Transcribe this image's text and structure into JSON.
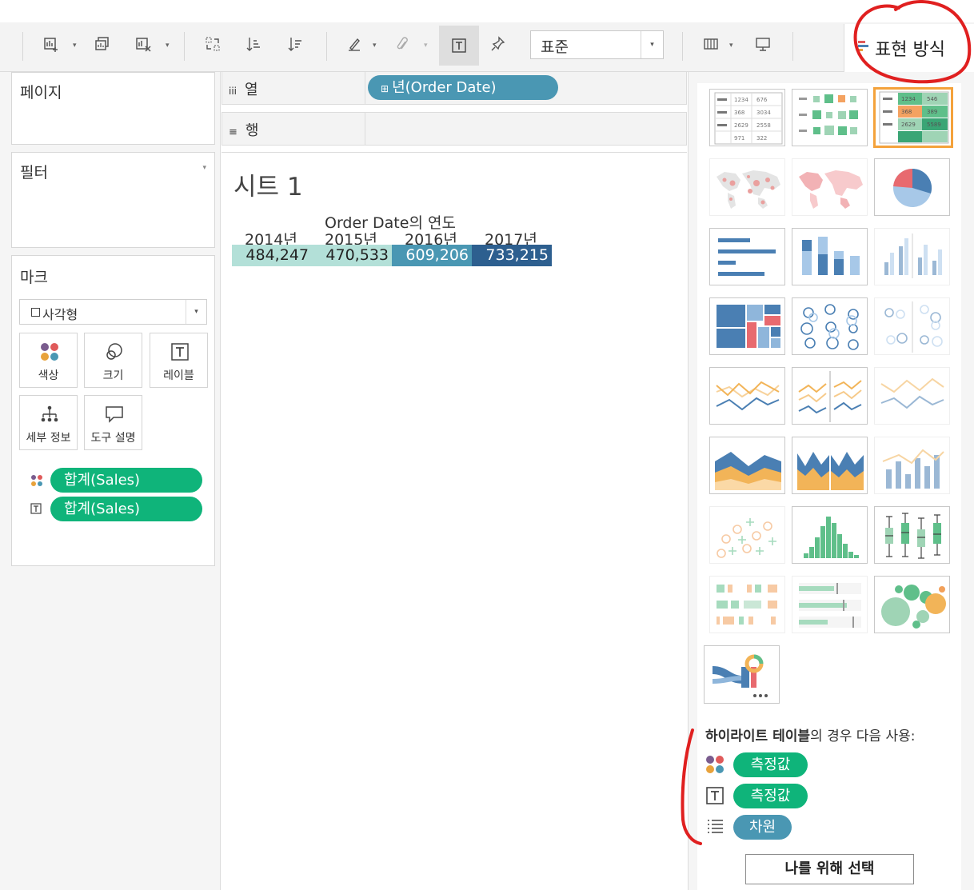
{
  "toolbar": {
    "zoom_value": "표준",
    "show_me_label": "표현 방식"
  },
  "panels": {
    "pages_title": "페이지",
    "filters_title": "필터",
    "marks_title": "마크",
    "mark_type": "사각형",
    "mark_cards": [
      "색상",
      "크기",
      "레이블",
      "세부 정보",
      "도구 설명"
    ],
    "mark_pills": [
      "합계(Sales)",
      "합계(Sales)"
    ]
  },
  "shelves": {
    "columns_label": "열",
    "rows_label": "행",
    "columns_pill": "년(Order Date)"
  },
  "worksheet": {
    "title": "시트 1",
    "column_header": "Order Date의 연도",
    "years": [
      "2014년",
      "2015년",
      "2016년",
      "2017년"
    ],
    "values": [
      "484,247",
      "470,533",
      "609,206",
      "733,215"
    ],
    "cell_colors": [
      "#b3e0d8",
      "#b3e0d8",
      "#4a97b3",
      "#2d5f8f"
    ],
    "cell_text_colors": [
      "#222222",
      "#222222",
      "#ffffff",
      "#ffffff"
    ]
  },
  "show_me": {
    "hint_bold": "하이라이트 테이블",
    "hint_rest": "의 경우 다음 사용:",
    "requirements": [
      "측정값",
      "측정값",
      "차원"
    ],
    "choose_button": "나를 위해 선택",
    "thumb_number_labels": [
      "1234",
      "676",
      "368",
      "3034",
      "2629",
      "2558",
      "971",
      "322",
      "546",
      "389",
      "5589"
    ]
  },
  "colors": {
    "measure_pill": "#0fb47a",
    "dimension_pill": "#4a97b3",
    "selection_border": "#f4a23b",
    "annotation_red": "#e02020"
  }
}
